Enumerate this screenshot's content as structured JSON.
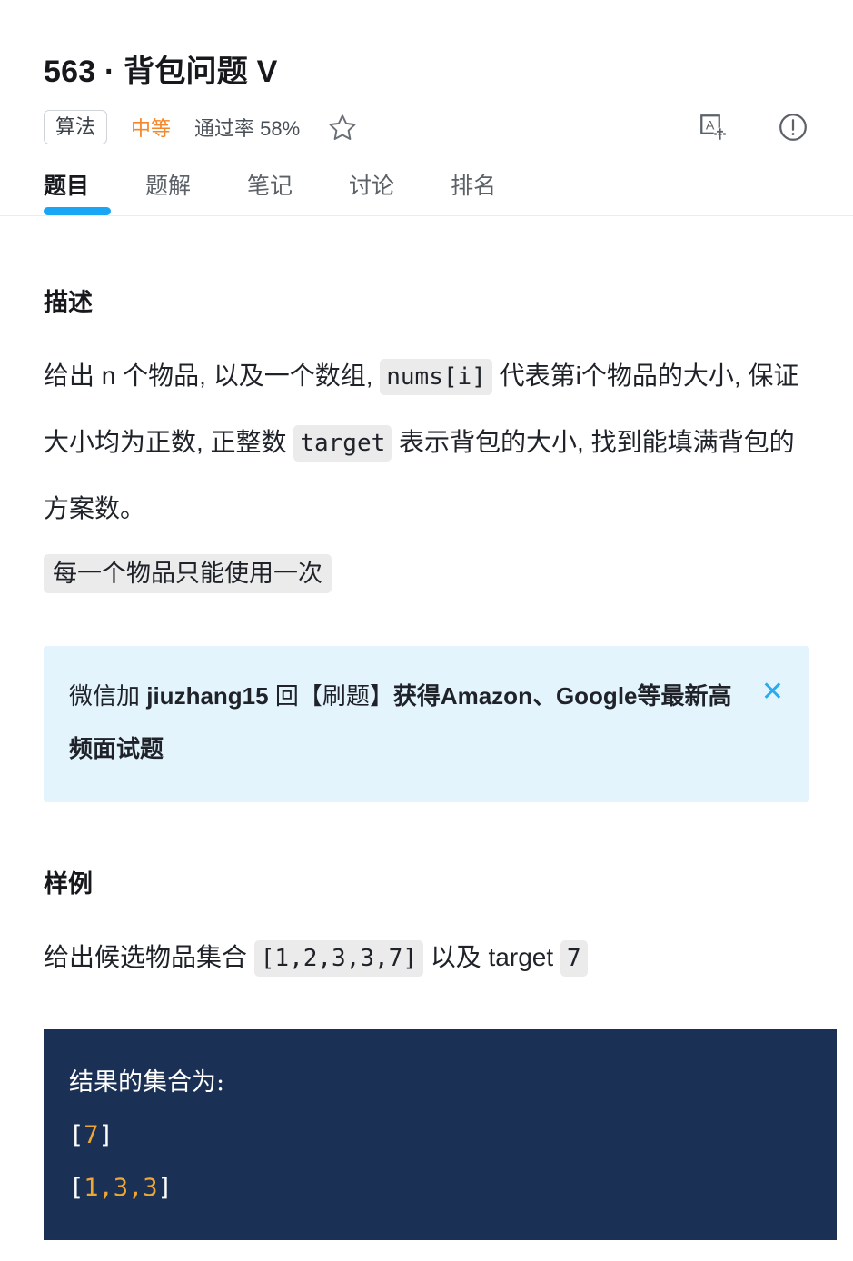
{
  "header": {
    "problem_number": "563",
    "separator": " · ",
    "problem_title": "背包问题 V",
    "category_tag": "算法",
    "difficulty": "中等",
    "difficulty_color": "#f5872a",
    "accept_rate_label": "通过率 58%",
    "icons": {
      "star": "star-icon",
      "translate": "translate-icon",
      "info": "info-circle-icon"
    }
  },
  "tabs": [
    {
      "label": "题目",
      "active": true
    },
    {
      "label": "题解",
      "active": false
    },
    {
      "label": "笔记",
      "active": false
    },
    {
      "label": "讨论",
      "active": false
    },
    {
      "label": "排名",
      "active": false
    }
  ],
  "active_tab_color": "#1ba6f5",
  "description": {
    "heading": "描述",
    "part1": "给出 n 个物品, 以及一个数组, ",
    "code1": "nums[i]",
    "part2": " 代表第i个物品的大小, 保证大小均为正数, 正整数 ",
    "code2": "target",
    "part3": " 表示背包的大小, 找到能填满背包的方案数。",
    "note_code": "每一个物品只能使用一次"
  },
  "promo": {
    "text_light": "微信加 ",
    "text_bold1": "jiuzhang15",
    "text_light2": " 回【刷题】",
    "text_bold2": "获得Amazon、Google等最新高频面试题",
    "close_label": "✕",
    "background": "#e3f4fd",
    "close_color": "#29aaf2"
  },
  "sample": {
    "heading": "样例",
    "line_part1": "给出候选物品集合 ",
    "code_set": "[1,2,3,3,7]",
    "line_part2": " 以及 target ",
    "code_target": "7"
  },
  "code_block": {
    "title_line": "结果的集合为:",
    "line2_open": "[",
    "line2_nums": "7",
    "line2_close": "]",
    "line3_open": "[",
    "line3_nums": "1,3,3",
    "line3_close": "]",
    "background": "#1b3055",
    "number_color": "#f0a732"
  }
}
